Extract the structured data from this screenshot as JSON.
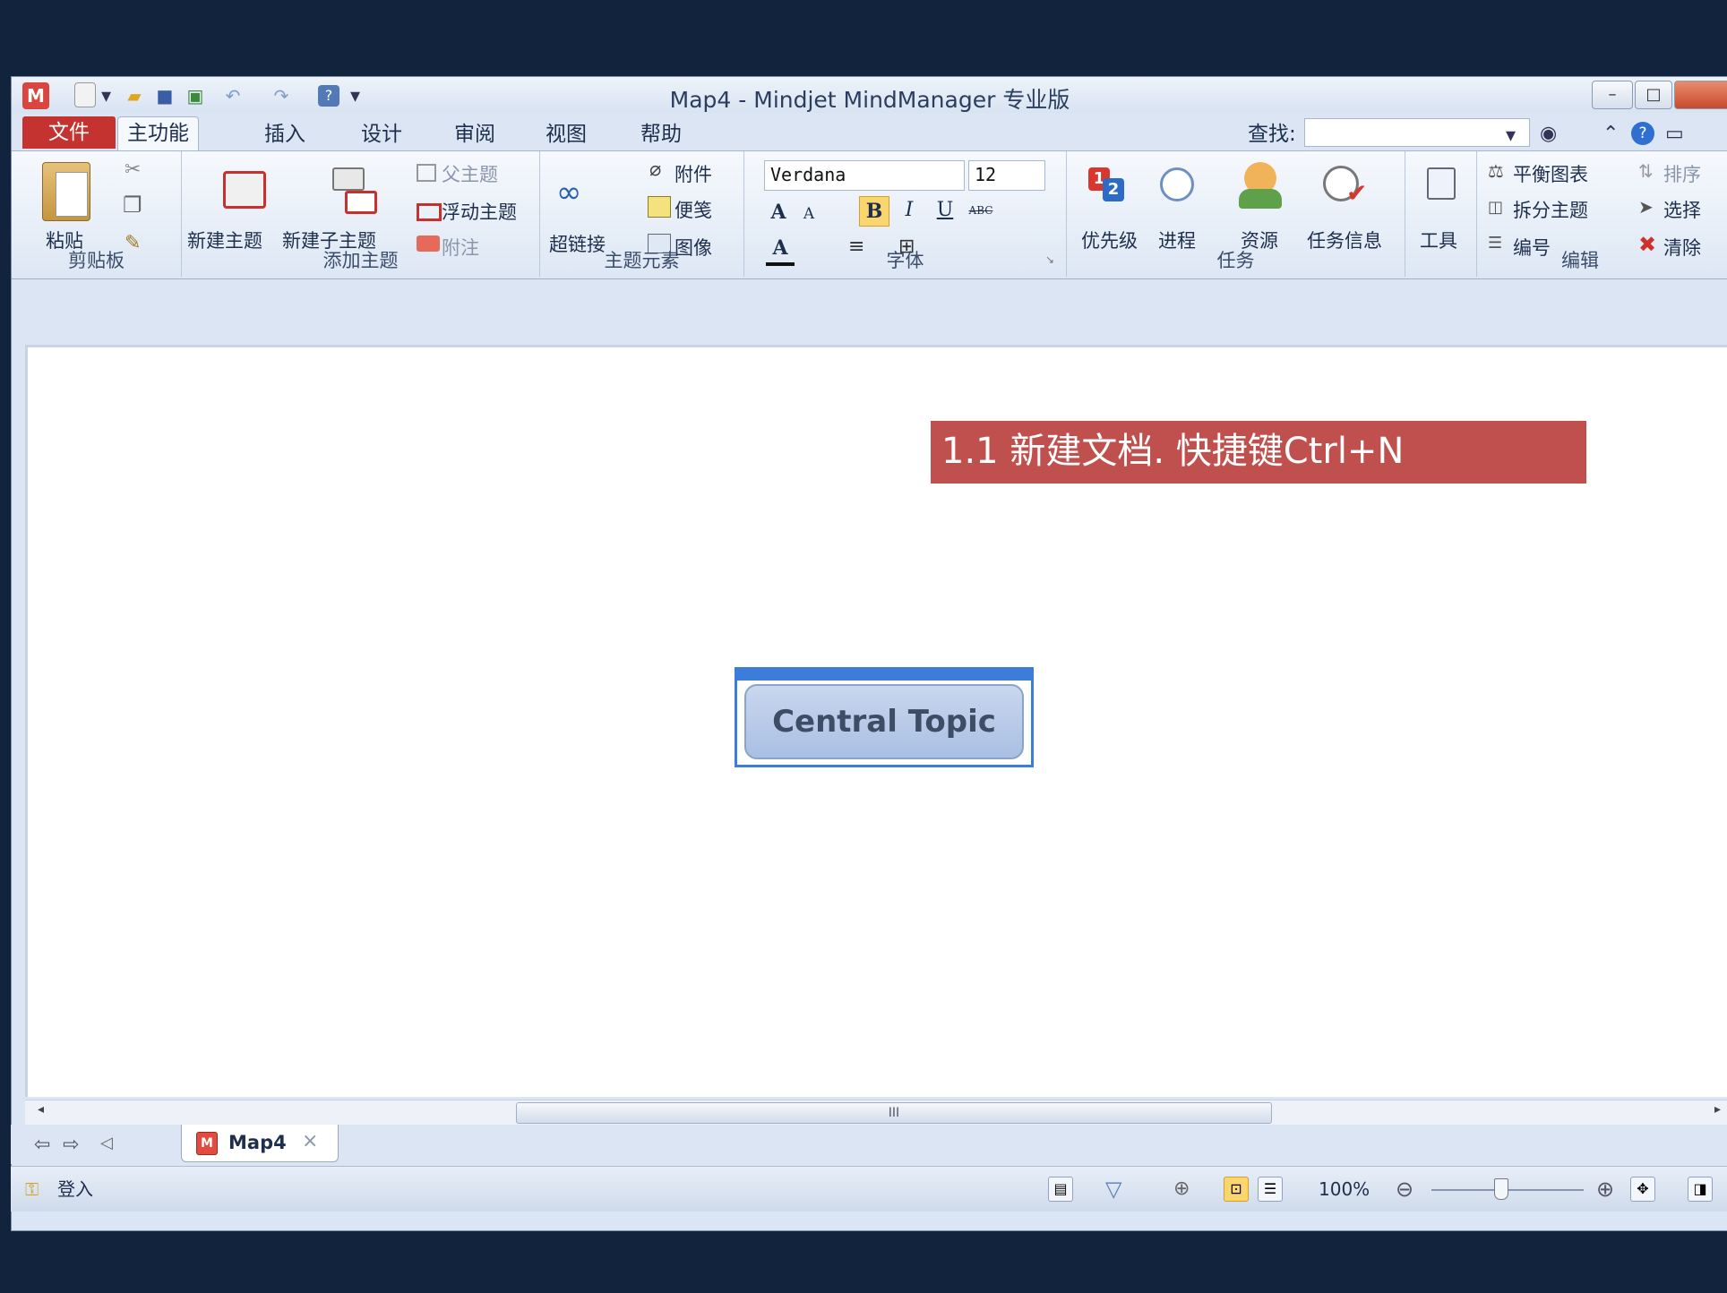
{
  "window": {
    "title": "Map4 - Mindjet MindManager 专业版"
  },
  "quick_access": {
    "icons": [
      "app-logo-icon",
      "new-doc-icon",
      "dropdown-icon",
      "open-folder-icon",
      "save-icon",
      "save-all-icon",
      "undo-icon",
      "redo-icon",
      "help-icon",
      "customize-icon"
    ],
    "help_glyph": "?"
  },
  "tabs": [
    "文件",
    "主功能",
    "插入",
    "设计",
    "审阅",
    "视图",
    "帮助"
  ],
  "find": {
    "label": "查找:",
    "value": ""
  },
  "ribbon": {
    "clipboard": {
      "paste": "粘贴",
      "label": "剪贴板"
    },
    "add_topic": {
      "new_topic": "新建主题",
      "new_subtopic": "新建子主题",
      "parent_topic": "父主题",
      "floating_topic": "浮动主题",
      "callout": "附注",
      "label": "添加主题"
    },
    "topic_elements": {
      "hyperlink": "超链接",
      "attachment": "附件",
      "notes": "便笺",
      "image": "图像",
      "label": "主题元素"
    },
    "font": {
      "family": "Verdana",
      "size": "12",
      "grow": "A",
      "shrink": "A",
      "bold": "B",
      "italic": "I",
      "underline": "U",
      "strike": "ABC",
      "color_glyph": "A",
      "label": "字体"
    },
    "task": {
      "priority": "优先级",
      "progress": "进程",
      "resource": "资源",
      "task_info": "任务信息",
      "label": "任务"
    },
    "tools": {
      "tools": "工具"
    },
    "edit": {
      "balance_map": "平衡图表",
      "split_topic": "拆分主题",
      "numbering": "编号",
      "sort": "排序",
      "select": "选择",
      "clear": "清除",
      "label": "编辑"
    }
  },
  "canvas": {
    "banner": "1.1 新建文档. 快捷键Ctrl+N",
    "central_topic": "Central Topic",
    "scroll_thumb_glyph": "III"
  },
  "doc_tabs": [
    {
      "label": "Map4",
      "close": "×"
    }
  ],
  "status": {
    "login": "登入",
    "zoom": "100%"
  },
  "colors": {
    "frame": "#12233d",
    "file_tab": "#c4332f",
    "banner": "#c0504d",
    "selection": "#3b7dd8",
    "topic_fill": "#b7c9e8"
  }
}
